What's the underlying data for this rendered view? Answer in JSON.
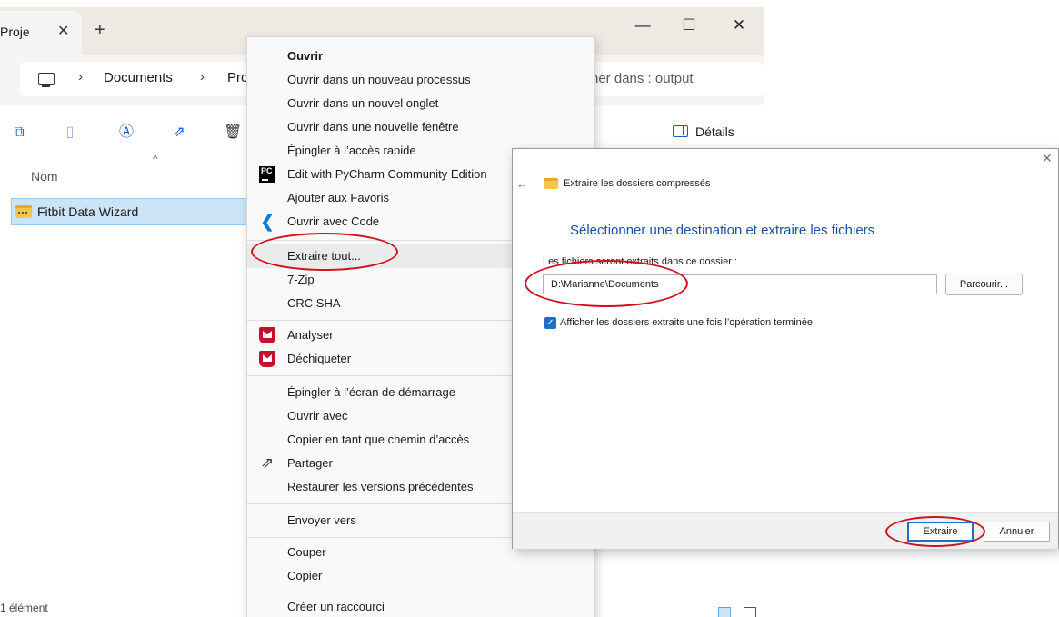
{
  "explorer": {
    "tab_label": "Proje",
    "tab_close": "✕",
    "new_tab": "+",
    "window_controls": {
      "minimize": "—",
      "maximize": "☐",
      "close": "✕"
    },
    "address": {
      "separator": "›",
      "segments": [
        "Documents",
        "Pro"
      ]
    },
    "search_text": "her dans : output",
    "toolbar_icons": [
      "copy-icon",
      "paste-icon",
      "rename-icon",
      "share-icon",
      "delete-icon"
    ],
    "details_label": "Détails",
    "column_header": "Nom",
    "sort_caret": "^",
    "file_name": "Fitbit Data Wizard",
    "status_text": "1 élément",
    "colors": {
      "selection": "#cce4f7",
      "accent": "#0e5fc9"
    }
  },
  "context_menu": {
    "items": [
      {
        "label": "Ouvrir",
        "bold": true
      },
      {
        "label": "Ouvrir dans un nouveau processus"
      },
      {
        "label": "Ouvrir dans un nouvel onglet"
      },
      {
        "label": "Ouvrir dans une nouvelle fenêtre"
      },
      {
        "label": "Épingler à l’accès rapide"
      },
      {
        "label": "Edit with PyCharm Community Edition",
        "icon": "pycharm-icon"
      },
      {
        "label": "Ajouter aux Favoris"
      },
      {
        "label": "Ouvrir avec Code",
        "icon": "vscode-icon"
      },
      {
        "label": "Extraire tout..."
      },
      {
        "label": "7-Zip"
      },
      {
        "label": "CRC SHA"
      },
      {
        "label": "Analyser",
        "icon": "mcafee-icon"
      },
      {
        "label": "Déchiqueter",
        "icon": "mcafee-icon"
      },
      {
        "label": "Épingler à l’écran de démarrage"
      },
      {
        "label": "Ouvrir avec"
      },
      {
        "label": "Copier en tant que chemin d’accès"
      },
      {
        "label": "Partager",
        "icon": "share-icon"
      },
      {
        "label": "Restaurer les versions précédentes"
      },
      {
        "label": "Envoyer vers"
      },
      {
        "label": "Couper"
      },
      {
        "label": "Copier"
      },
      {
        "label": "Créer un raccourci"
      }
    ],
    "pycharm_badge": "PC",
    "vscode_glyph": "❮"
  },
  "dialog": {
    "close": "✕",
    "back": "←",
    "title": "Extraire les dossiers compressés",
    "heading": "Sélectionner une destination et extraire les fichiers",
    "path_label": "Les fichiers seront extraits dans ce dossier :",
    "path_value": "D:\\Marianne\\Documents",
    "browse_label": "Parcourir...",
    "checkbox_checked": true,
    "checkbox_mark": "✓",
    "checkbox_label": "Afficher les dossiers extraits une fois l’opération terminée",
    "extract_label": "Extraire",
    "cancel_label": "Annuler",
    "colors": {
      "heading": "#1c4fa3",
      "primary_border": "#1f6fc9"
    }
  },
  "annotations": {
    "ellipse_color": "#d0101a"
  }
}
